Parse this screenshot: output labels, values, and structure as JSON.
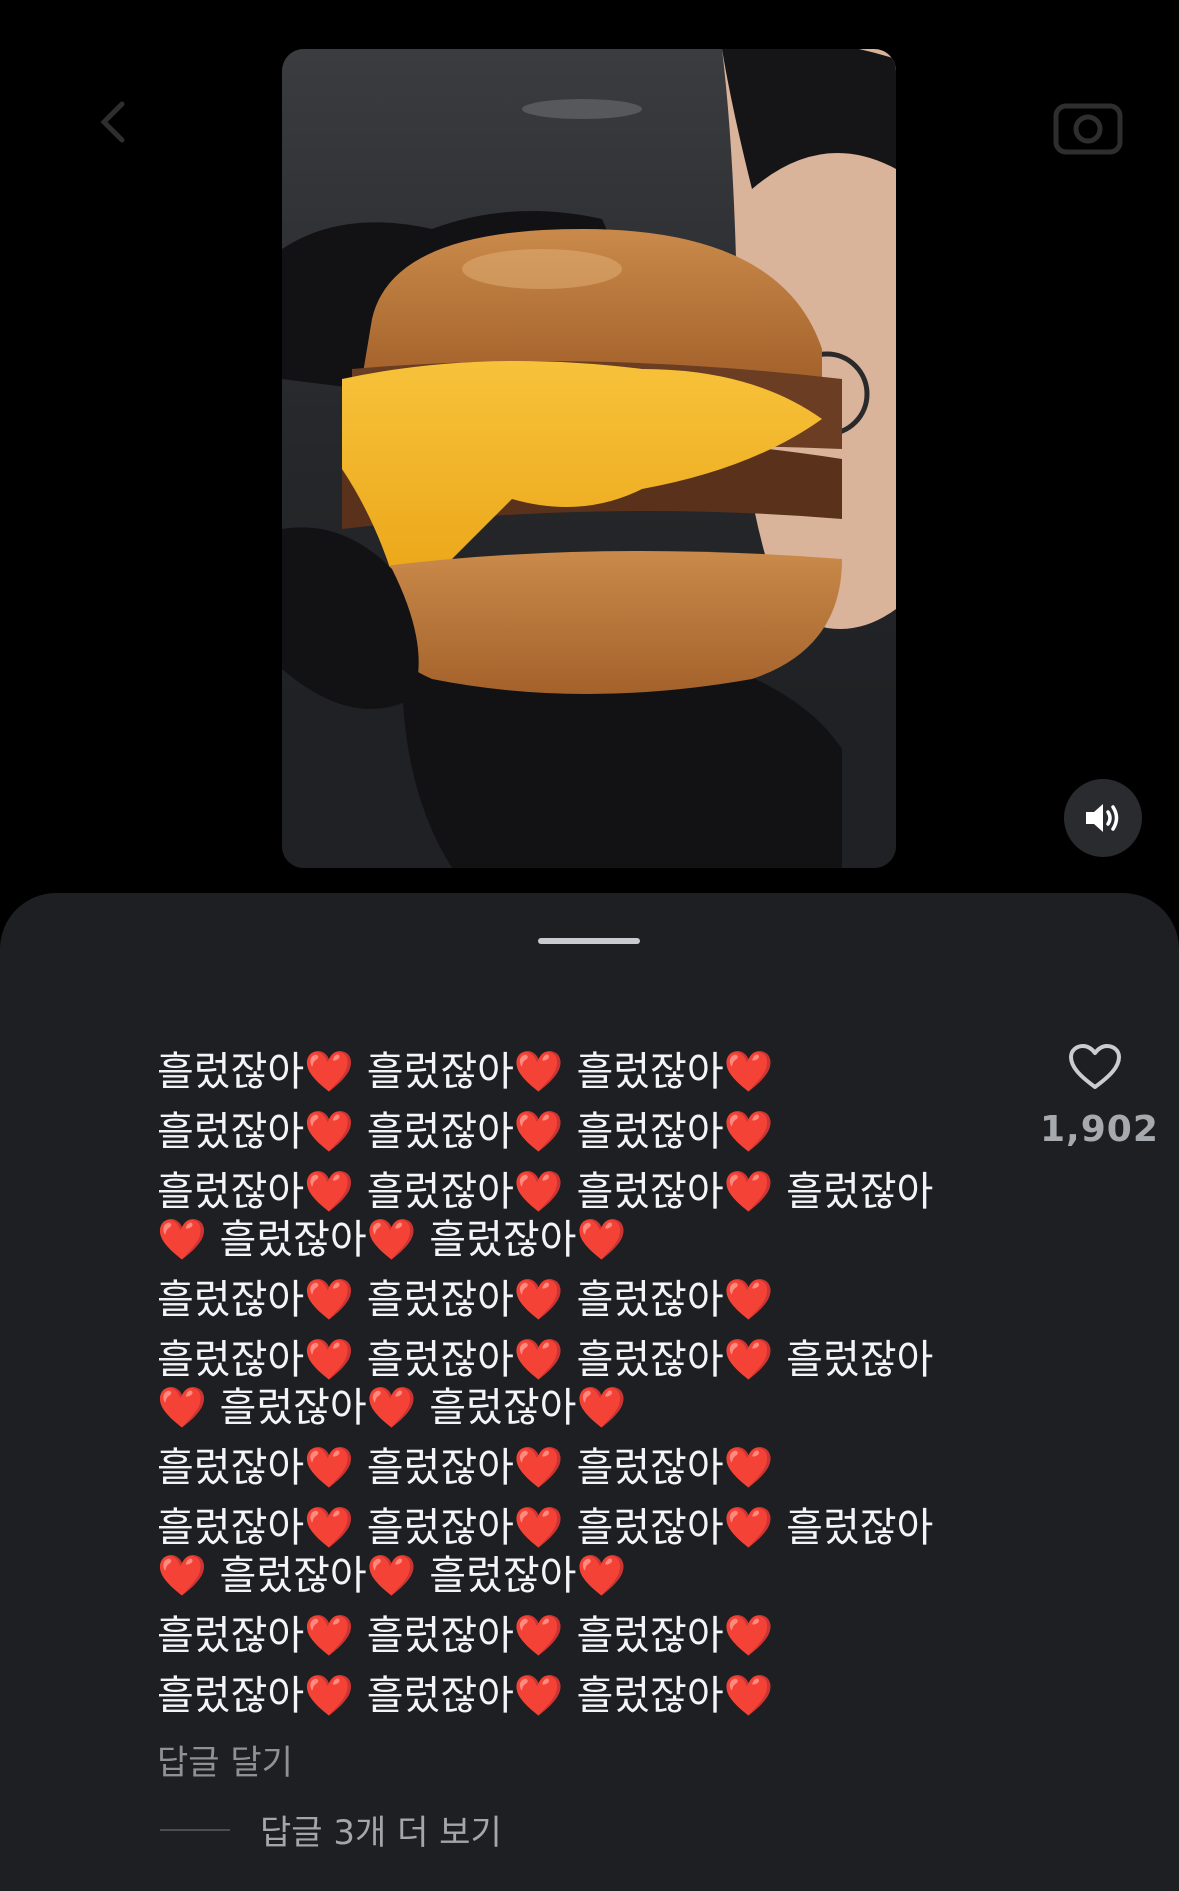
{
  "top_bar": {
    "back_icon": "chevron-left-icon",
    "camera_icon": "camera-icon"
  },
  "video": {
    "description_icon": "video-frame",
    "mute_icon": "speaker-volume-icon"
  },
  "comment": {
    "lines": [
      "흘렀잖아❤️ 흘렀잖아❤️ 흘렀잖아❤️",
      "흘렀잖아❤️ 흘렀잖아❤️ 흘렀잖아❤️",
      "흘렀잖아❤️ 흘렀잖아❤️ 흘렀잖아❤️ 흘렀잖아\n❤️ 흘렀잖아❤️ 흘렀잖아❤️",
      "흘렀잖아❤️ 흘렀잖아❤️ 흘렀잖아❤️",
      "흘렀잖아❤️ 흘렀잖아❤️ 흘렀잖아❤️ 흘렀잖아\n❤️ 흘렀잖아❤️ 흘렀잖아❤️",
      "흘렀잖아❤️ 흘렀잖아❤️ 흘렀잖아❤️",
      "흘렀잖아❤️ 흘렀잖아❤️ 흘렀잖아❤️ 흘렀잖아\n❤️ 흘렀잖아❤️ 흘렀잖아❤️",
      "흘렀잖아❤️ 흘렀잖아❤️ 흘렀잖아❤️",
      "흘렀잖아❤️ 흘렀잖아❤️ 흘렀잖아❤️"
    ],
    "like_icon": "heart-outline-icon",
    "like_count": "1,902",
    "reply_label": "답글 달기",
    "more_replies_label": "답글 3개 더 보기"
  },
  "colors": {
    "sheet_bg": "#1d1f22",
    "page_bg": "#000000",
    "heart": "#e8323c"
  }
}
